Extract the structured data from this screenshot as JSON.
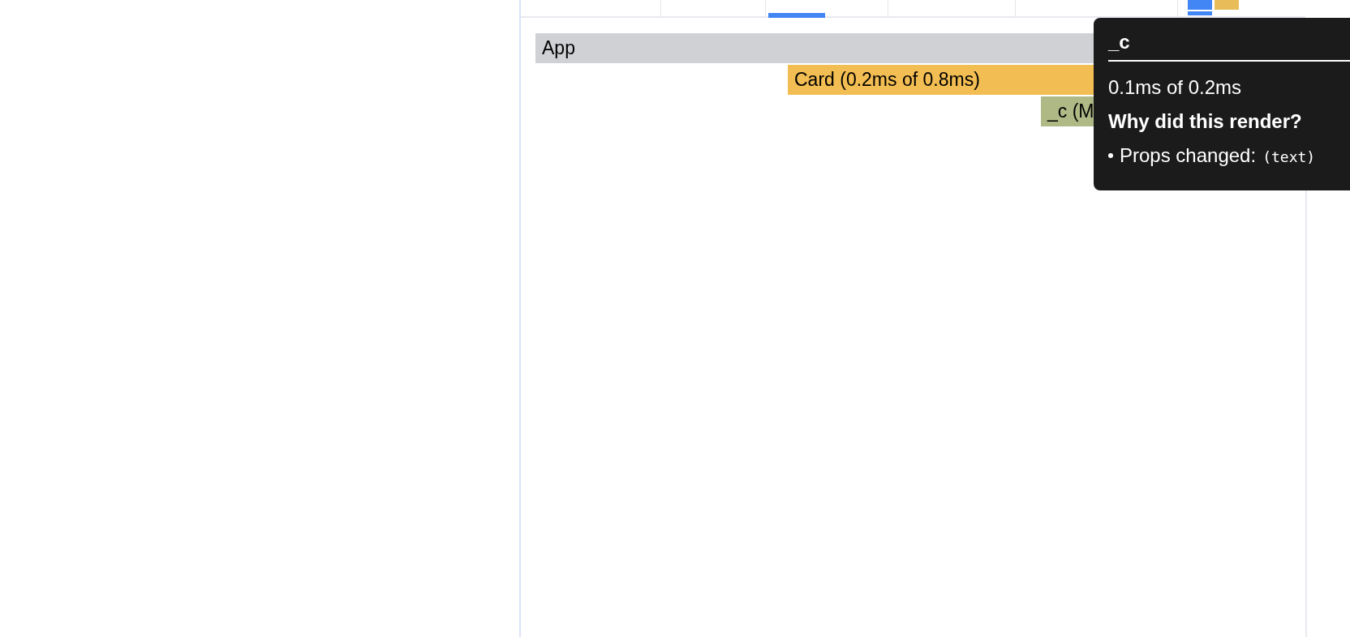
{
  "commits": [
    {
      "selected": true,
      "color": "#4285f4"
    },
    {
      "selected": false,
      "color": "#e8bd59"
    }
  ],
  "timeline_ticks": [
    {
      "selected": false
    },
    {
      "selected": false
    },
    {
      "selected": true
    },
    {
      "selected": false
    },
    {
      "selected": false
    }
  ],
  "flame_rows": [
    {
      "bars": [
        {
          "label": "App",
          "color": "#d0d1d5"
        }
      ]
    },
    {
      "bars": [
        {
          "label": "Card (0.2ms of 0.8ms)",
          "color": "#f2bd52"
        }
      ]
    },
    {
      "bars": [
        {
          "label": "_c (M",
          "color": "#afb986"
        }
      ]
    }
  ],
  "tooltip": {
    "title": "_c",
    "duration": "0.1ms of 0.2ms",
    "heading": "Why did this render?",
    "reason": "Props changed:",
    "props": "(text)"
  }
}
